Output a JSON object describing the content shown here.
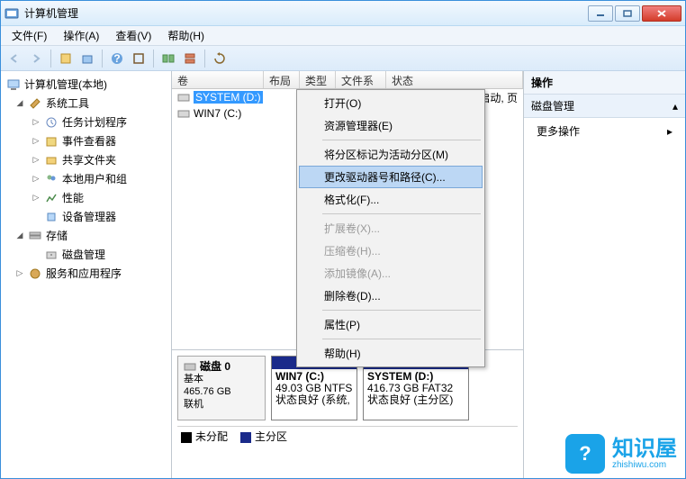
{
  "window": {
    "title": "计算机管理"
  },
  "menubar": [
    "文件(F)",
    "操作(A)",
    "查看(V)",
    "帮助(H)"
  ],
  "tree": {
    "root": "计算机管理(本地)",
    "groups": [
      {
        "label": "系统工具",
        "expanded": true,
        "children": [
          "任务计划程序",
          "事件查看器",
          "共享文件夹",
          "本地用户和组",
          "性能",
          "设备管理器"
        ]
      },
      {
        "label": "存储",
        "expanded": true,
        "children": [
          "磁盘管理"
        ]
      },
      {
        "label": "服务和应用程序",
        "expanded": false,
        "children": []
      }
    ]
  },
  "columns": {
    "vol": "卷",
    "layout": "布局",
    "type": "类型",
    "fs": "文件系统",
    "status": "状态"
  },
  "volumes": [
    {
      "name": "SYSTEM (D:)",
      "selected": true,
      "extra": "启动, 页"
    },
    {
      "name": "WIN7 (C:)",
      "selected": false,
      "extra": ""
    }
  ],
  "context_menu": {
    "items": [
      {
        "label": "打开(O)",
        "enabled": true
      },
      {
        "label": "资源管理器(E)",
        "enabled": true
      },
      {
        "sep": true
      },
      {
        "label": "将分区标记为活动分区(M)",
        "enabled": true
      },
      {
        "label": "更改驱动器号和路径(C)...",
        "enabled": true,
        "hover": true
      },
      {
        "label": "格式化(F)...",
        "enabled": true
      },
      {
        "sep": true
      },
      {
        "label": "扩展卷(X)...",
        "enabled": false
      },
      {
        "label": "压缩卷(H)...",
        "enabled": false
      },
      {
        "label": "添加镜像(A)...",
        "enabled": false
      },
      {
        "label": "删除卷(D)...",
        "enabled": true
      },
      {
        "sep": true
      },
      {
        "label": "属性(P)",
        "enabled": true
      },
      {
        "sep": true
      },
      {
        "label": "帮助(H)",
        "enabled": true
      }
    ]
  },
  "disk": {
    "header": {
      "name": "磁盘 0",
      "type": "基本",
      "size": "465.76 GB",
      "status": "联机"
    },
    "partitions": [
      {
        "name": "WIN7  (C:)",
        "size": "49.03 GB NTFS",
        "status": "状态良好 (系统,",
        "width": 96
      },
      {
        "name": "SYSTEM  (D:)",
        "size": "416.73 GB FAT32",
        "status": "状态良好 (主分区)",
        "width": 118
      }
    ],
    "legend": {
      "unalloc": "未分配",
      "primary": "主分区"
    }
  },
  "actions": {
    "title": "操作",
    "section": "磁盘管理",
    "more": "更多操作"
  },
  "watermark": {
    "name": "知识屋",
    "url": "zhishiwu.com",
    "glyph": "?"
  }
}
